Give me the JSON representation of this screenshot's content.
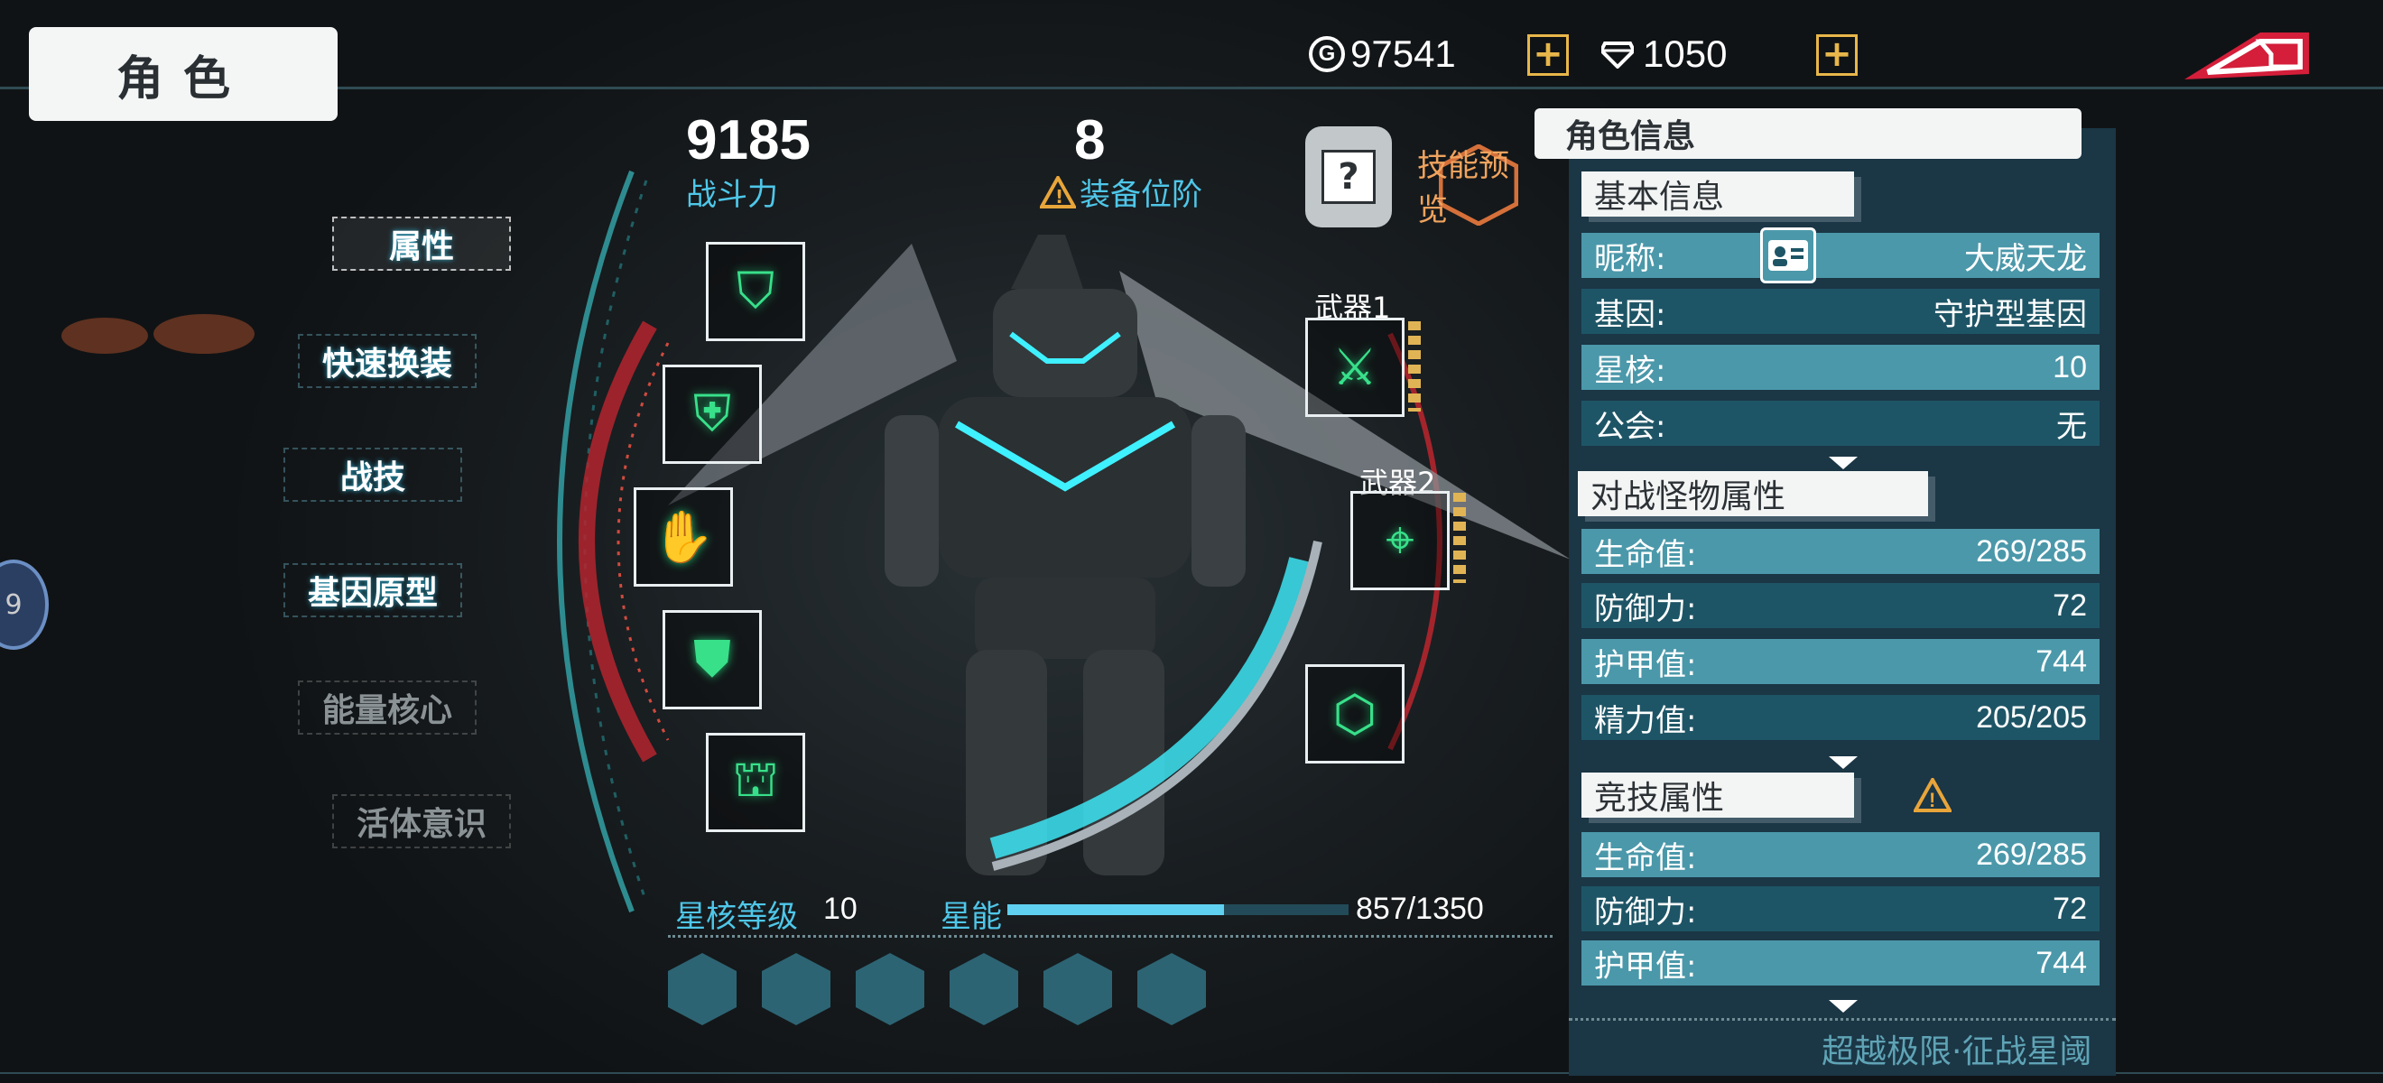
{
  "header": {
    "title": "角色",
    "gold": "97541",
    "gem": "1050",
    "gold_icon": "G",
    "colors": {
      "accent": "#4fc7e9",
      "plus": "#e8b64a",
      "warning": "#e8a53a",
      "back": "#d41e3a"
    }
  },
  "nav": {
    "items": [
      {
        "label": "属性",
        "state": "selected"
      },
      {
        "label": "快速换装",
        "state": "active"
      },
      {
        "label": "战技",
        "state": "active"
      },
      {
        "label": "基因原型",
        "state": "active"
      },
      {
        "label": "能量核心",
        "state": "locked"
      },
      {
        "label": "活体意识",
        "state": "locked"
      }
    ],
    "side_orb": "9"
  },
  "stats": {
    "power_value": "9185",
    "power_label": "战斗力",
    "equip_value": "8",
    "equip_label": "装备位阶",
    "skill_preview": "技能预览",
    "unknown_mark": "?"
  },
  "equipment": {
    "weapon1": "武器1",
    "weapon2": "武器2",
    "icons": [
      "helmet-icon",
      "chest-icon",
      "glove-icon",
      "belt-icon",
      "leg-icon",
      "weapon1-icon",
      "weapon2-icon",
      "relic-icon"
    ]
  },
  "bottom": {
    "star_level_label": "星核等级",
    "star_level": "10",
    "star_energy_label": "星能",
    "star_energy": "857/1350",
    "star_energy_fraction": 0.635,
    "hex_slots": 6,
    "slogan": "超越极限·征战星阈"
  },
  "panel": {
    "title": "角色信息",
    "basic": {
      "tag": "基本信息",
      "rows": [
        {
          "label": "昵称:",
          "value": "大威天龙"
        },
        {
          "label": "基因:",
          "value": "守护型基因"
        },
        {
          "label": "星核:",
          "value": "10"
        },
        {
          "label": "公会:",
          "value": "无"
        }
      ]
    },
    "pve": {
      "tag": "对战怪物属性",
      "rows": [
        {
          "label": "生命值:",
          "value": "269/285"
        },
        {
          "label": "防御力:",
          "value": "72"
        },
        {
          "label": "护甲值:",
          "value": "744"
        },
        {
          "label": "精力值:",
          "value": "205/205"
        }
      ]
    },
    "pvp": {
      "tag": "竞技属性",
      "rows": [
        {
          "label": "生命值:",
          "value": "269/285"
        },
        {
          "label": "防御力:",
          "value": "72"
        },
        {
          "label": "护甲值:",
          "value": "744"
        }
      ]
    }
  }
}
